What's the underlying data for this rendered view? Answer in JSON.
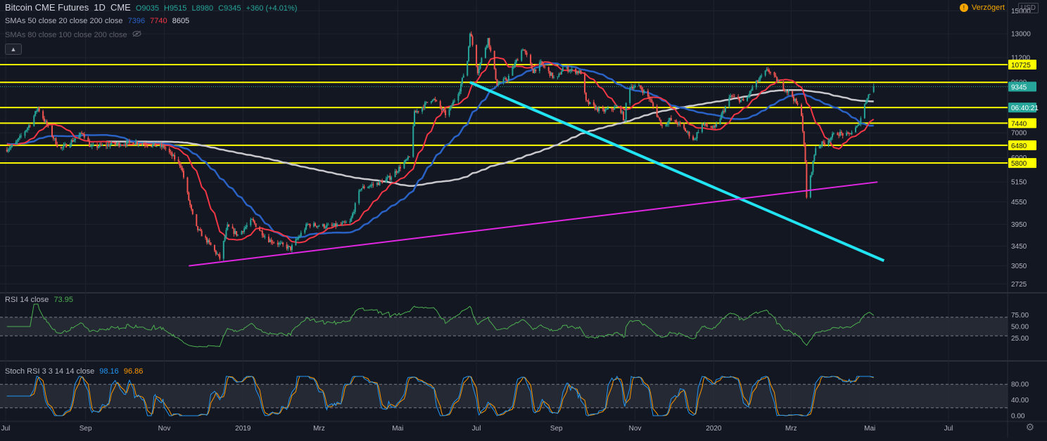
{
  "header": {
    "symbol": "Bitcoin CME Futures",
    "interval": "1D",
    "exchange": "CME",
    "ohlc": {
      "o": "O9035",
      "h": "H9515",
      "l": "L8980",
      "c": "C9345",
      "change": "+360 (+4.01%)"
    },
    "sma_line_1": {
      "label": "SMAs 50 close 20 close 200 close",
      "v1": "7396",
      "v2": "7740",
      "v3": "8605"
    },
    "sma_line_2": {
      "label": "SMAs 80 close 100 close 200 close"
    },
    "delayed_label": "Verzögert",
    "currency": "USD"
  },
  "chart_data": [
    {
      "type": "candlestick",
      "title": "Bitcoin CME Futures",
      "interval": "1D",
      "y_scale": "log",
      "ylim": [
        2600,
        15500
      ],
      "y_ticks": [
        "15000",
        "13000",
        "11200",
        "9600",
        "8200",
        "7000",
        "6000",
        "5150",
        "4550",
        "3950",
        "3450",
        "3050",
        "2725"
      ],
      "x_ticks": [
        "Jul",
        "Sep",
        "Nov",
        "2019",
        "Mrz",
        "Mai",
        "Jul",
        "Sep",
        "Nov",
        "2020",
        "Mrz",
        "Mai",
        "Jul"
      ],
      "x_tick_dates": [
        "2018-07-01",
        "2018-09-01",
        "2018-11-01",
        "2019-01-01",
        "2019-03-01",
        "2019-05-01",
        "2019-07-01",
        "2019-09-01",
        "2019-11-01",
        "2020-01-01",
        "2020-03-01",
        "2020-05-01",
        "2020-07-01"
      ],
      "price_keypoints": [
        [
          "2018-07-01",
          6300
        ],
        [
          "2018-07-08",
          6500
        ],
        [
          "2018-07-20",
          7400
        ],
        [
          "2018-07-26",
          8200
        ],
        [
          "2018-08-05",
          7000
        ],
        [
          "2018-08-12",
          6300
        ],
        [
          "2018-08-30",
          7000
        ],
        [
          "2018-09-05",
          6400
        ],
        [
          "2018-09-20",
          6500
        ],
        [
          "2018-10-10",
          6600
        ],
        [
          "2018-11-01",
          6400
        ],
        [
          "2018-11-14",
          5700
        ],
        [
          "2018-11-20",
          4600
        ],
        [
          "2018-11-25",
          3900
        ],
        [
          "2018-12-06",
          3500
        ],
        [
          "2018-12-14",
          3200
        ],
        [
          "2018-12-20",
          3900
        ],
        [
          "2018-12-28",
          3700
        ],
        [
          "2019-01-08",
          4050
        ],
        [
          "2019-01-20",
          3600
        ],
        [
          "2019-02-07",
          3400
        ],
        [
          "2019-02-20",
          3950
        ],
        [
          "2019-03-10",
          3900
        ],
        [
          "2019-03-25",
          4000
        ],
        [
          "2019-04-02",
          4950
        ],
        [
          "2019-04-15",
          5100
        ],
        [
          "2019-04-25",
          5300
        ],
        [
          "2019-05-10",
          6000
        ],
        [
          "2019-05-14",
          7900
        ],
        [
          "2019-05-28",
          8700
        ],
        [
          "2019-06-08",
          7800
        ],
        [
          "2019-06-18",
          9200
        ],
        [
          "2019-06-24",
          11000
        ],
        [
          "2019-06-26",
          13200
        ],
        [
          "2019-07-02",
          10300
        ],
        [
          "2019-07-10",
          12600
        ],
        [
          "2019-07-17",
          9500
        ],
        [
          "2019-07-25",
          9800
        ],
        [
          "2019-08-06",
          11900
        ],
        [
          "2019-08-14",
          10300
        ],
        [
          "2019-08-20",
          10800
        ],
        [
          "2019-09-01",
          9700
        ],
        [
          "2019-09-06",
          10500
        ],
        [
          "2019-09-20",
          10200
        ],
        [
          "2019-09-24",
          8500
        ],
        [
          "2019-10-06",
          8000
        ],
        [
          "2019-10-20",
          8250
        ],
        [
          "2019-10-24",
          7500
        ],
        [
          "2019-10-26",
          9400
        ],
        [
          "2019-11-05",
          9300
        ],
        [
          "2019-11-12",
          8700
        ],
        [
          "2019-11-22",
          7300
        ],
        [
          "2019-11-28",
          7600
        ],
        [
          "2019-12-05",
          7400
        ],
        [
          "2019-12-17",
          6700
        ],
        [
          "2019-12-22",
          7400
        ],
        [
          "2020-01-02",
          7200
        ],
        [
          "2020-01-14",
          8800
        ],
        [
          "2020-01-25",
          8500
        ],
        [
          "2020-02-01",
          9400
        ],
        [
          "2020-02-12",
          10400
        ],
        [
          "2020-02-20",
          9600
        ],
        [
          "2020-03-02",
          8800
        ],
        [
          "2020-03-09",
          7900
        ],
        [
          "2020-03-12",
          5800
        ],
        [
          "2020-03-13",
          4700
        ],
        [
          "2020-03-16",
          5300
        ],
        [
          "2020-03-20",
          6400
        ],
        [
          "2020-03-27",
          6600
        ],
        [
          "2020-04-05",
          7000
        ],
        [
          "2020-04-14",
          6900
        ],
        [
          "2020-04-22",
          7300
        ],
        [
          "2020-04-29",
          8800
        ],
        [
          "2020-05-02",
          9000
        ],
        [
          "2020-05-04",
          9345
        ]
      ],
      "horizontal_levels": [
        "10725",
        "9600",
        "8200",
        "7440",
        "6480",
        "5800"
      ],
      "last_price_label": "9345",
      "countdown_label": "06:40:21",
      "trendlines": [
        {
          "color": "#22e3f2",
          "from": [
            "2019-06-26",
            9600
          ],
          "to": [
            "2020-05-12",
            3150
          ]
        },
        {
          "color": "#e026e0",
          "from": [
            "2018-11-20",
            3050
          ],
          "to": [
            "2020-05-07",
            5150
          ]
        }
      ],
      "sma_colors": {
        "sma50": "#2962c4",
        "sma20": "#f23645",
        "sma200": "#c8c8cc"
      },
      "candle_colors": {
        "up": "#26a69a",
        "down": "#ef5350"
      },
      "level_color": "#ffff00"
    },
    {
      "type": "line",
      "title": "RSI 14 close",
      "last_value": "73.95",
      "ylim": [
        0,
        100
      ],
      "y_ticks": [
        "75.00",
        "50.00",
        "25.00"
      ],
      "band": [
        30,
        70
      ],
      "color": "#4caf50"
    },
    {
      "type": "line",
      "title": "Stoch RSI 3 3 14 14 close",
      "k_value": "98.16",
      "d_value": "96.86",
      "ylim": [
        0,
        100
      ],
      "y_ticks": [
        "80.00",
        "40.00",
        "0.00"
      ],
      "band": [
        20,
        80
      ],
      "k_color": "#2196f3",
      "d_color": "#ff9800"
    }
  ]
}
